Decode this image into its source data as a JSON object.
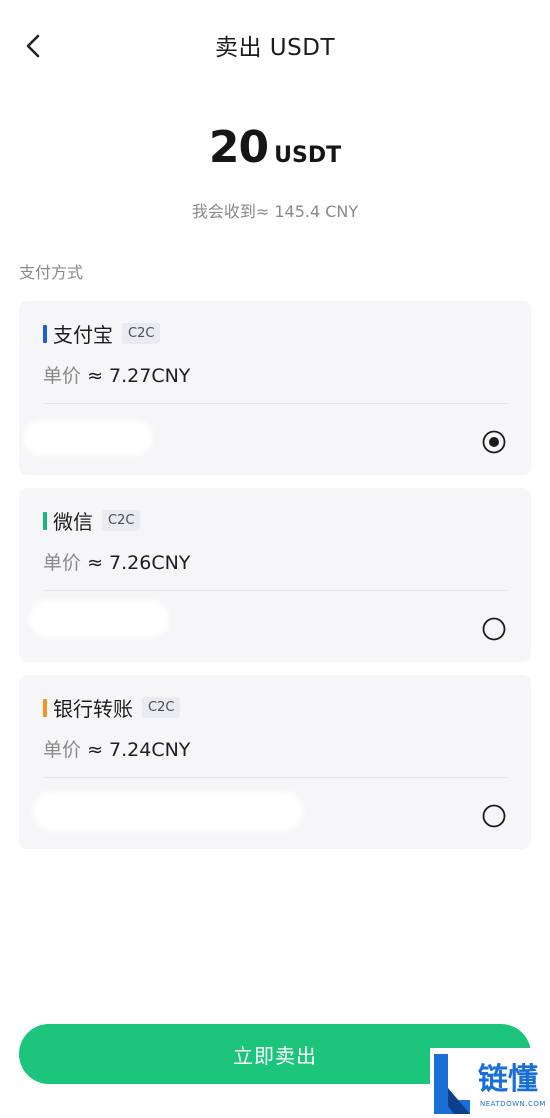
{
  "header": {
    "title": "卖出 USDT",
    "back_icon": "chevron-left-icon"
  },
  "amount": {
    "value": "20",
    "unit": "USDT"
  },
  "receive_text": "我会收到≈ 145.4 CNY",
  "section_label": "支付方式",
  "methods": [
    {
      "name": "支付宝",
      "tag": "C2C",
      "price_label": "单价",
      "price_value": "≈ 7.27CNY",
      "bar_color": "#1b5fd1",
      "selected": true
    },
    {
      "name": "微信",
      "tag": "C2C",
      "price_label": "单价",
      "price_value": "≈ 7.26CNY",
      "bar_color": "#17b67a",
      "selected": false
    },
    {
      "name": "银行转账",
      "tag": "C2C",
      "price_label": "单价",
      "price_value": "≈ 7.24CNY",
      "bar_color": "#f5941e",
      "selected": false
    }
  ],
  "submit_label": "立即卖出",
  "watermark": {
    "text": "链懂",
    "sub": "NEATDOWN.COM"
  },
  "colors": {
    "accent_green": "#1dc47c",
    "card_bg": "#f6f6f8",
    "muted_text": "#8a8a8a"
  }
}
